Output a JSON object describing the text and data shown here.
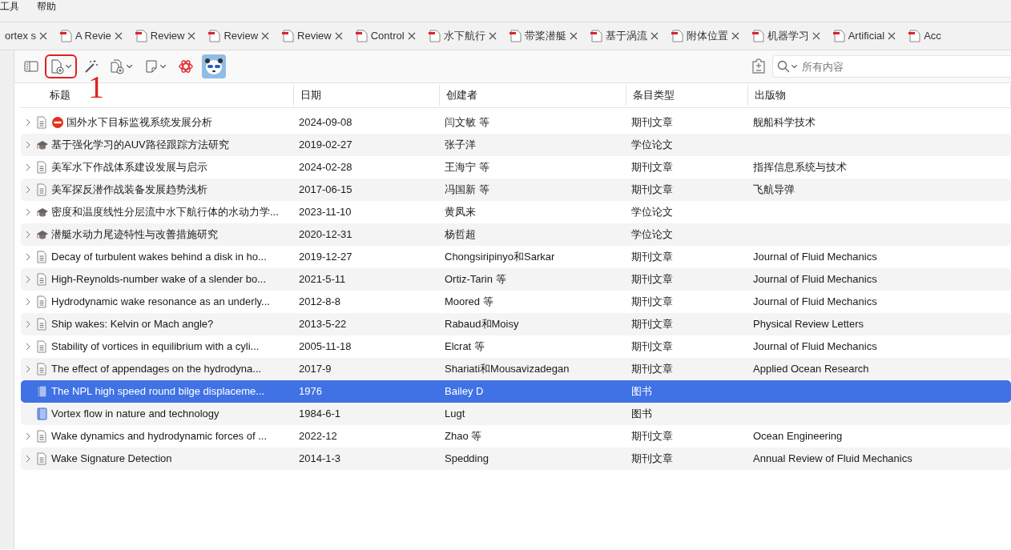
{
  "menu": [
    "工具",
    "帮助"
  ],
  "tabs": [
    {
      "label": "ortex s"
    },
    {
      "label": "A Revie"
    },
    {
      "label": "Review"
    },
    {
      "label": "Review"
    },
    {
      "label": "Review"
    },
    {
      "label": "Control"
    },
    {
      "label": "水下航行"
    },
    {
      "label": "带桨潜艇"
    },
    {
      "label": "基于涡流"
    },
    {
      "label": "附体位置"
    },
    {
      "label": "机器学习"
    },
    {
      "label": "Artificial"
    },
    {
      "label": "Acc"
    }
  ],
  "search": {
    "placeholder": "所有内容"
  },
  "annotation": {
    "label": "1"
  },
  "table": {
    "columns": [
      "标题",
      "日期",
      "创建者",
      "条目类型",
      "出版物"
    ],
    "rows": [
      {
        "kind": "article",
        "expandable": true,
        "error": true,
        "selected": false,
        "title": "国外水下目标监视系统发展分析",
        "date": "2024-09-08",
        "creator": "闫文敏 等",
        "type": "期刊文章",
        "publication": "舰船科学技术"
      },
      {
        "kind": "thesis",
        "expandable": true,
        "error": false,
        "selected": false,
        "title": "基于强化学习的AUV路径跟踪方法研究",
        "date": "2019-02-27",
        "creator": "张子洋",
        "type": "学位论文",
        "publication": ""
      },
      {
        "kind": "article",
        "expandable": true,
        "error": false,
        "selected": false,
        "title": "美军水下作战体系建设发展与启示",
        "date": "2024-02-28",
        "creator": "王海宁 等",
        "type": "期刊文章",
        "publication": "指挥信息系统与技术"
      },
      {
        "kind": "article",
        "expandable": true,
        "error": false,
        "selected": false,
        "title": "美军探反潜作战装备发展趋势浅析",
        "date": "2017-06-15",
        "creator": "冯国新 等",
        "type": "期刊文章",
        "publication": "飞航导弹"
      },
      {
        "kind": "thesis",
        "expandable": true,
        "error": false,
        "selected": false,
        "title": "密度和温度线性分层流中水下航行体的水动力学...",
        "date": "2023-11-10",
        "creator": "黄凤来",
        "type": "学位论文",
        "publication": ""
      },
      {
        "kind": "thesis",
        "expandable": true,
        "error": false,
        "selected": false,
        "title": "潜艇水动力尾迹特性与改善措施研究",
        "date": "2020-12-31",
        "creator": "杨哲超",
        "type": "学位论文",
        "publication": ""
      },
      {
        "kind": "article",
        "expandable": true,
        "error": false,
        "selected": false,
        "title": "Decay of turbulent wakes behind a disk in ho...",
        "date": "2019-12-27",
        "creator": "Chongsiripinyo和Sarkar",
        "type": "期刊文章",
        "publication": "Journal of Fluid Mechanics"
      },
      {
        "kind": "article",
        "expandable": true,
        "error": false,
        "selected": false,
        "title": "High-Reynolds-number wake of a slender bo...",
        "date": "2021-5-11",
        "creator": "Ortiz-Tarin 等",
        "type": "期刊文章",
        "publication": "Journal of Fluid Mechanics"
      },
      {
        "kind": "article",
        "expandable": true,
        "error": false,
        "selected": false,
        "title": "Hydrodynamic wake resonance as an underly...",
        "date": "2012-8-8",
        "creator": "Moored 等",
        "type": "期刊文章",
        "publication": "Journal of Fluid Mechanics"
      },
      {
        "kind": "article",
        "expandable": true,
        "error": false,
        "selected": false,
        "title": "Ship wakes: Kelvin or Mach angle?",
        "date": "2013-5-22",
        "creator": "Rabaud和Moisy",
        "type": "期刊文章",
        "publication": "Physical Review Letters"
      },
      {
        "kind": "article",
        "expandable": true,
        "error": false,
        "selected": false,
        "title": "Stability of vortices in equilibrium with a cyli...",
        "date": "2005-11-18",
        "creator": "Elcrat 等",
        "type": "期刊文章",
        "publication": "Journal of Fluid Mechanics"
      },
      {
        "kind": "article",
        "expandable": true,
        "error": false,
        "selected": false,
        "title": "The effect of appendages on the hydrodyna...",
        "date": "2017-9",
        "creator": "Shariati和Mousavizadegan",
        "type": "期刊文章",
        "publication": "Applied Ocean Research"
      },
      {
        "kind": "book",
        "expandable": false,
        "error": false,
        "selected": true,
        "title": "The NPL high speed round bilge displaceme...",
        "date": "1976",
        "creator": "Bailey D",
        "type": "图书",
        "publication": ""
      },
      {
        "kind": "book",
        "expandable": false,
        "error": false,
        "selected": false,
        "title": "Vortex flow in nature and technology",
        "date": "1984-6-1",
        "creator": "Lugt",
        "type": "图书",
        "publication": ""
      },
      {
        "kind": "article",
        "expandable": true,
        "error": false,
        "selected": false,
        "title": "Wake dynamics and hydrodynamic forces of ...",
        "date": "2022-12",
        "creator": "Zhao 等",
        "type": "期刊文章",
        "publication": "Ocean Engineering"
      },
      {
        "kind": "article",
        "expandable": true,
        "error": false,
        "selected": false,
        "title": "Wake Signature Detection",
        "date": "2014-1-3",
        "creator": "Spedding",
        "type": "期刊文章",
        "publication": "Annual Review of Fluid Mechanics"
      }
    ]
  }
}
